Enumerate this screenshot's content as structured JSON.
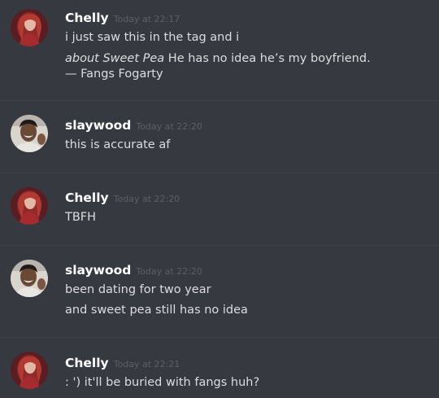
{
  "messages": [
    {
      "user": "Chelly",
      "time": "Today at 22:17",
      "avatar": "red-haired-girl-avatar",
      "lines": [
        "i just saw this in the tag and i"
      ],
      "quote": {
        "italic": "about Sweet Pea",
        "text": " He has no idea he’s my boyfriend.",
        "attribution": "— Fangs Fogarty"
      }
    },
    {
      "user": "slaywood",
      "time": "Today at 22:20",
      "avatar": "smiling-man-avatar",
      "lines": [
        "this is accurate af"
      ]
    },
    {
      "user": "Chelly",
      "time": "Today at 22:20",
      "avatar": "red-haired-girl-avatar",
      "lines": [
        "TBFH"
      ]
    },
    {
      "user": "slaywood",
      "time": "Today at 22:20",
      "avatar": "smiling-man-avatar",
      "lines": [
        "been dating for two year",
        "and sweet pea still has no idea"
      ]
    },
    {
      "user": "Chelly",
      "time": "Today at 22:21",
      "avatar": "red-haired-girl-avatar",
      "lines": [
        ": ') it'll be buried with fangs huh?"
      ]
    }
  ],
  "colors": {
    "background": "#36393f",
    "username": "#ffffff",
    "timestamp": "#5c5f66",
    "message_text": "#dcddde",
    "divider": "#3f4248"
  }
}
